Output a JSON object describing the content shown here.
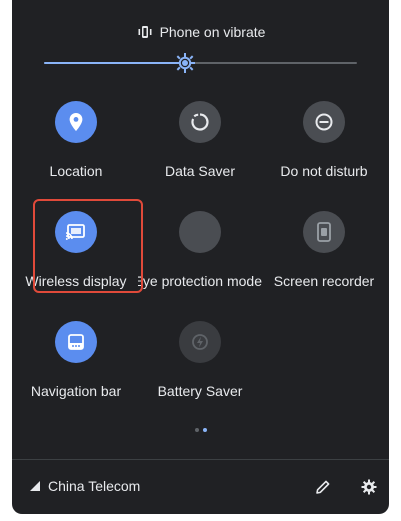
{
  "status": {
    "label": "Phone on vibrate",
    "icon": "vibrate-icon"
  },
  "brightness": {
    "value_fraction": 0.45
  },
  "tiles": [
    {
      "label": "Location",
      "icon": "location-icon",
      "state": "on"
    },
    {
      "label": "Data Saver",
      "icon": "data-saver-icon",
      "state": "off"
    },
    {
      "label": "Do not disturb",
      "icon": "do-not-disturb-icon",
      "state": "off"
    },
    {
      "label": "Wireless display",
      "icon": "cast-icon",
      "state": "on"
    },
    {
      "label": "Eye protection mode",
      "icon": "moon-icon",
      "state": "off"
    },
    {
      "label": "Screen recorder",
      "icon": "screen-recorder-icon",
      "state": "off"
    },
    {
      "label": "Navigation bar",
      "icon": "navigation-bar-icon",
      "state": "on"
    },
    {
      "label": "Battery Saver",
      "icon": "battery-saver-icon",
      "state": "disabled"
    }
  ],
  "pager": {
    "pages": 2,
    "current": 2
  },
  "footer": {
    "carrier": "China Telecom",
    "edit_icon": "pencil-icon",
    "settings_icon": "gear-icon"
  },
  "colors": {
    "panel": "#202124",
    "accent": "#5b8def",
    "tile_off": "#4a4d52",
    "highlight": "#e04a3a"
  }
}
